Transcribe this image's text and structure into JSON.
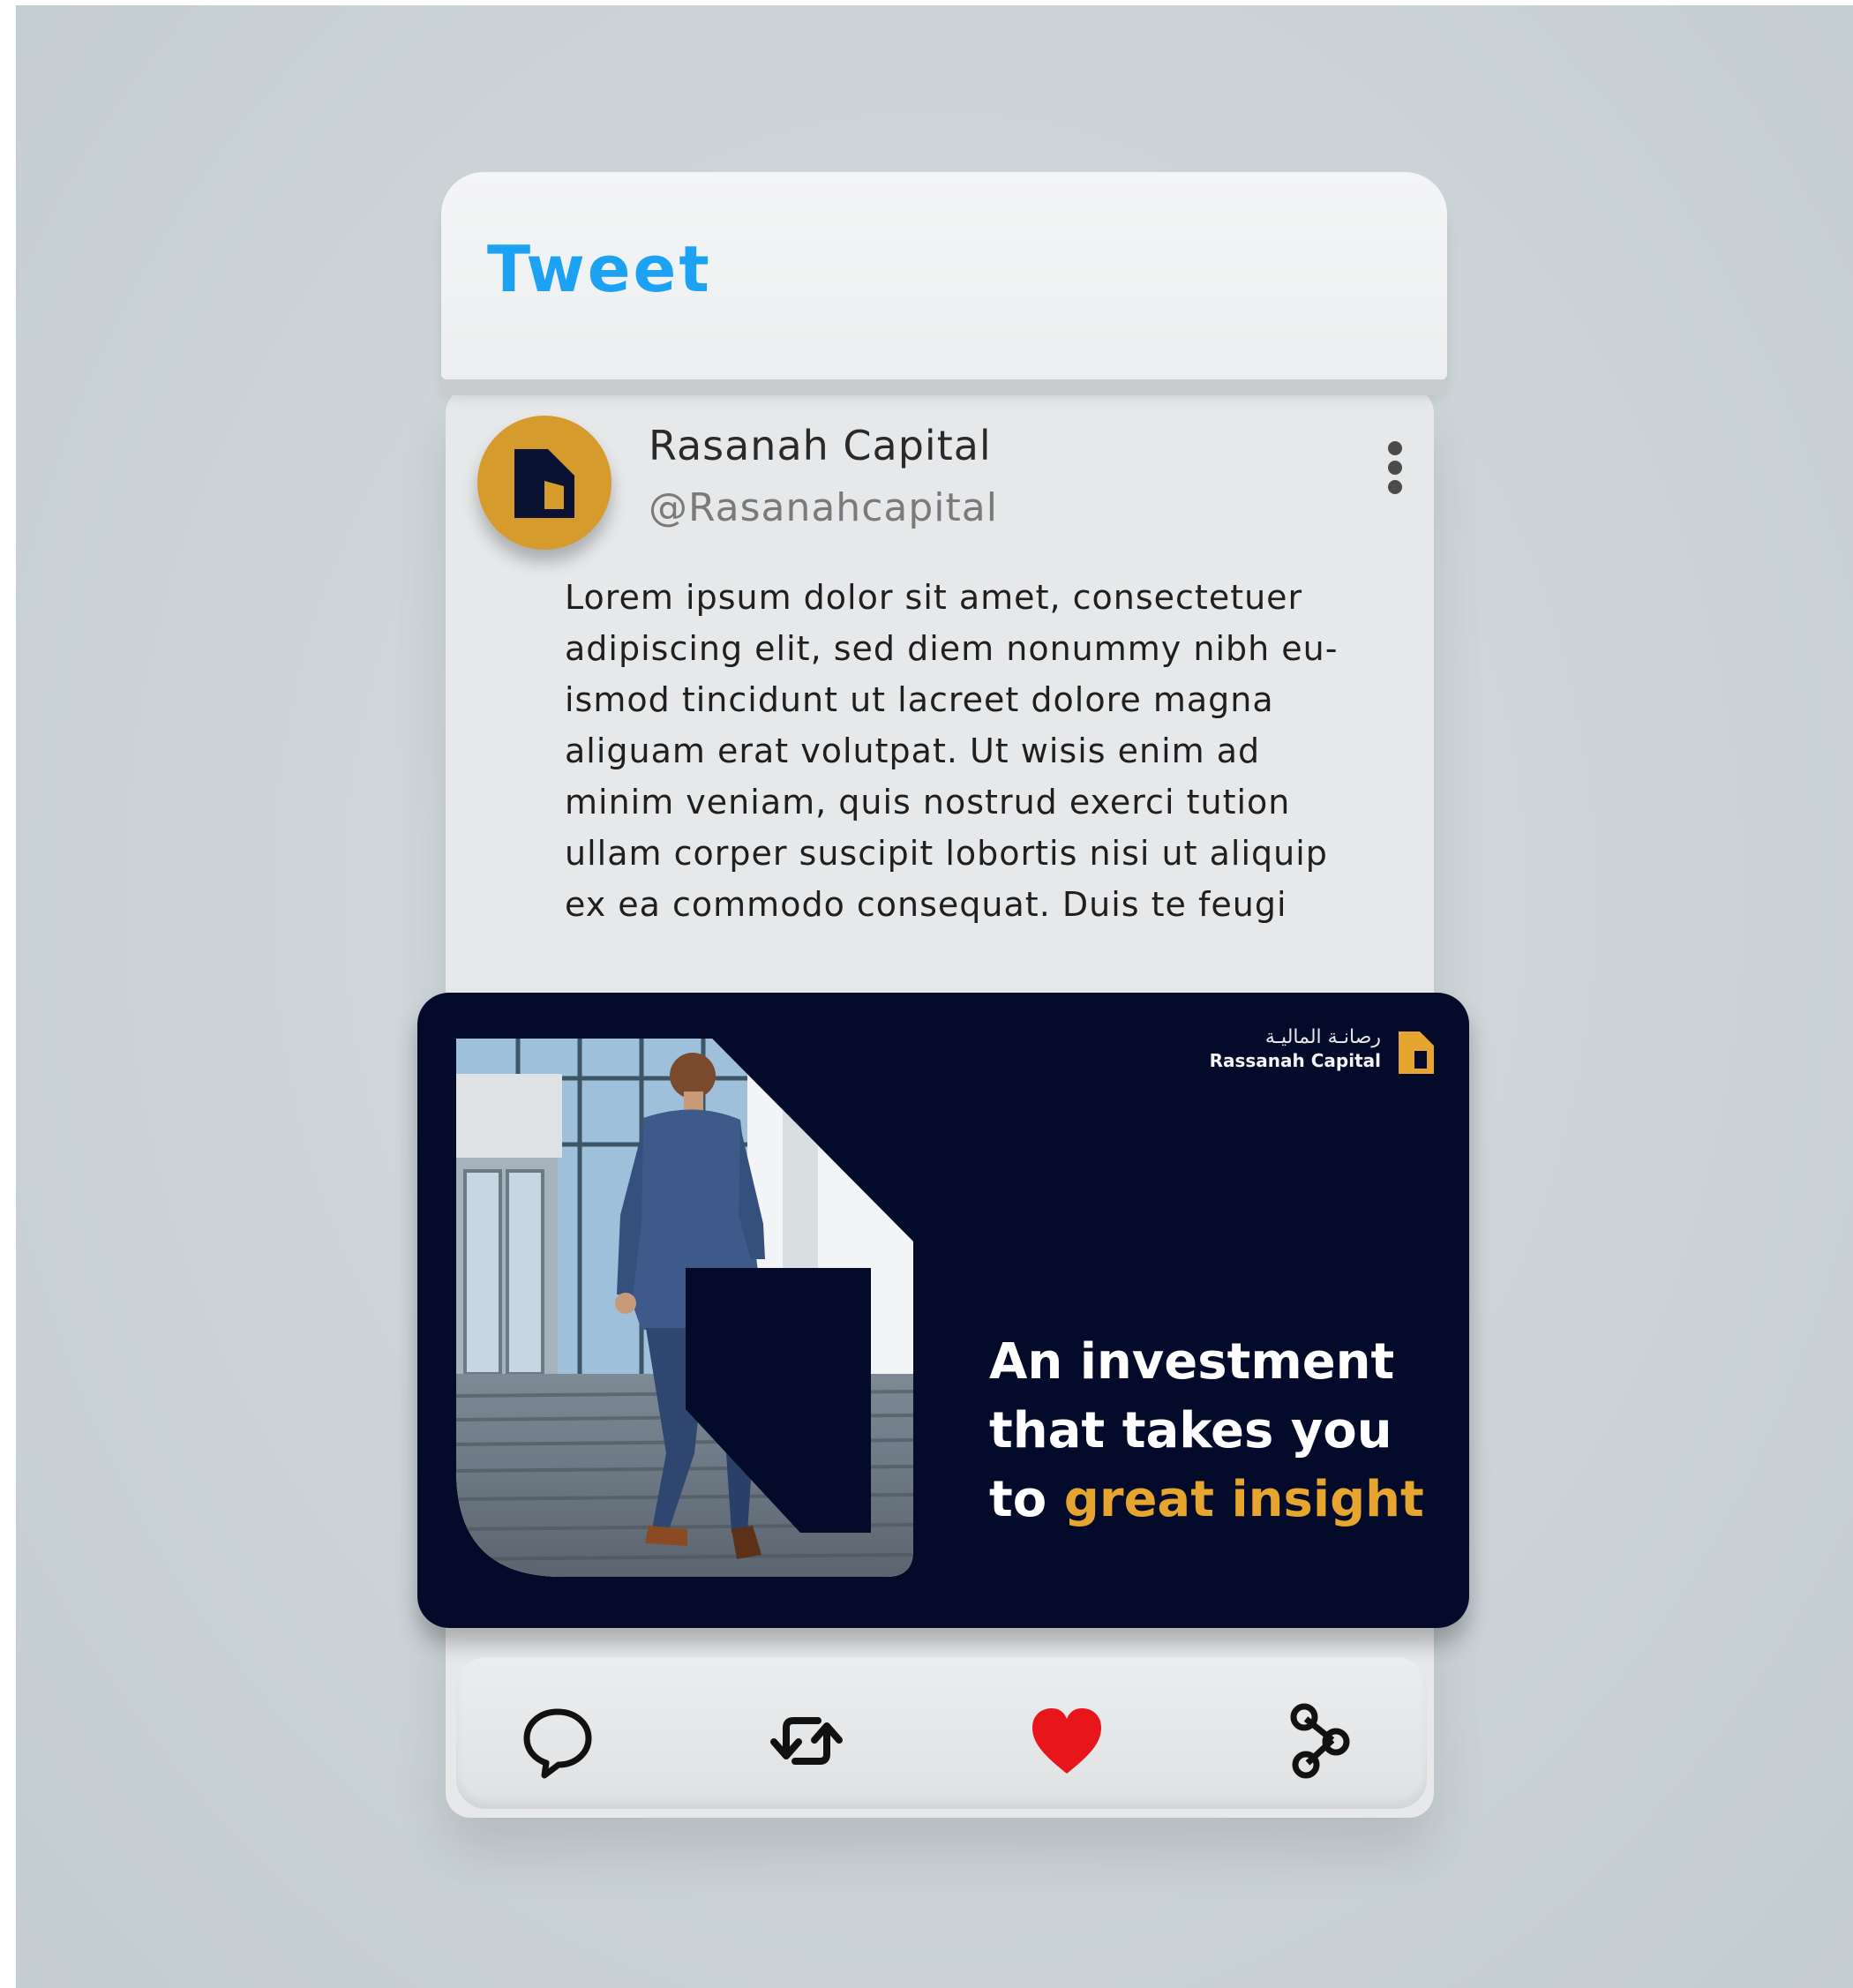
{
  "header": {
    "title": "Tweet"
  },
  "account": {
    "name": "Rasanah Capital",
    "handle": "@Rasanahcapital"
  },
  "tweet": {
    "lines": [
      "Lorem ipsum dolor sit amet, consectetuer",
      "adipiscing elit, sed diem nonummy nibh eu-",
      "ismod tincidunt ut lacreet dolore magna",
      "aliguam erat volutpat. Ut wisis enim ad",
      "minim veniam, quis nostrud exerci tution",
      "ullam corper suscipit lobortis nisi ut aliquip",
      "ex ea commodo consequat. Duis te feugi"
    ]
  },
  "media": {
    "brand_arabic": "رصانـة الماليـة",
    "brand_english": "Rassanah Capital",
    "headline_line1": "An investment",
    "headline_line2": "that takes you",
    "headline_line3_prefix": "to ",
    "headline_line3_accent": "great insight"
  },
  "actions": {
    "reply_icon": "comment-icon",
    "retweet_icon": "retweet-icon",
    "like_icon": "heart-icon",
    "share_icon": "share-icon"
  },
  "colors": {
    "brand_blue": "#1da1f2",
    "brand_gold": "#d59b2d",
    "navy": "#040a2a",
    "like_red": "#e8161b"
  }
}
